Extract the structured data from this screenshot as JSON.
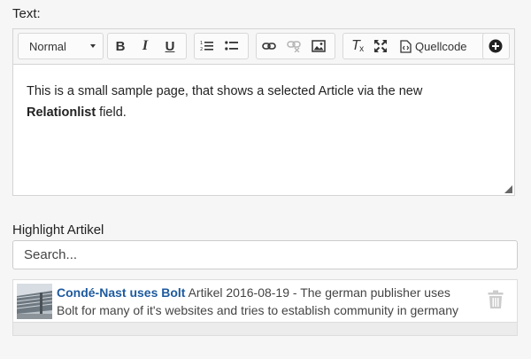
{
  "text_field": {
    "label": "Text:",
    "toolbar": {
      "format_select": "Normal",
      "source_label": "Quellcode",
      "buttons": [
        "bold-icon",
        "italic-icon",
        "underline-icon",
        "numbered-list-icon",
        "bulleted-list-icon",
        "link-icon",
        "unlink-icon",
        "image-icon",
        "remove-format-icon",
        "maximize-icon",
        "source-icon",
        "add-icon"
      ]
    },
    "content": {
      "line1": "This is a small sample page, that shows a selected Article via the new",
      "bold_word": "Relationlist",
      "line2_rest": " field."
    }
  },
  "relation_field": {
    "label": "Highlight Artikel",
    "search_placeholder": "Search...",
    "selected": [
      {
        "title": "Condé-Nast uses Bolt",
        "type": "Artikel",
        "date": "2016-08-19",
        "excerpt": "- The german publisher uses Bolt for many of it's websites and tries to establish community in germany …"
      }
    ]
  }
}
